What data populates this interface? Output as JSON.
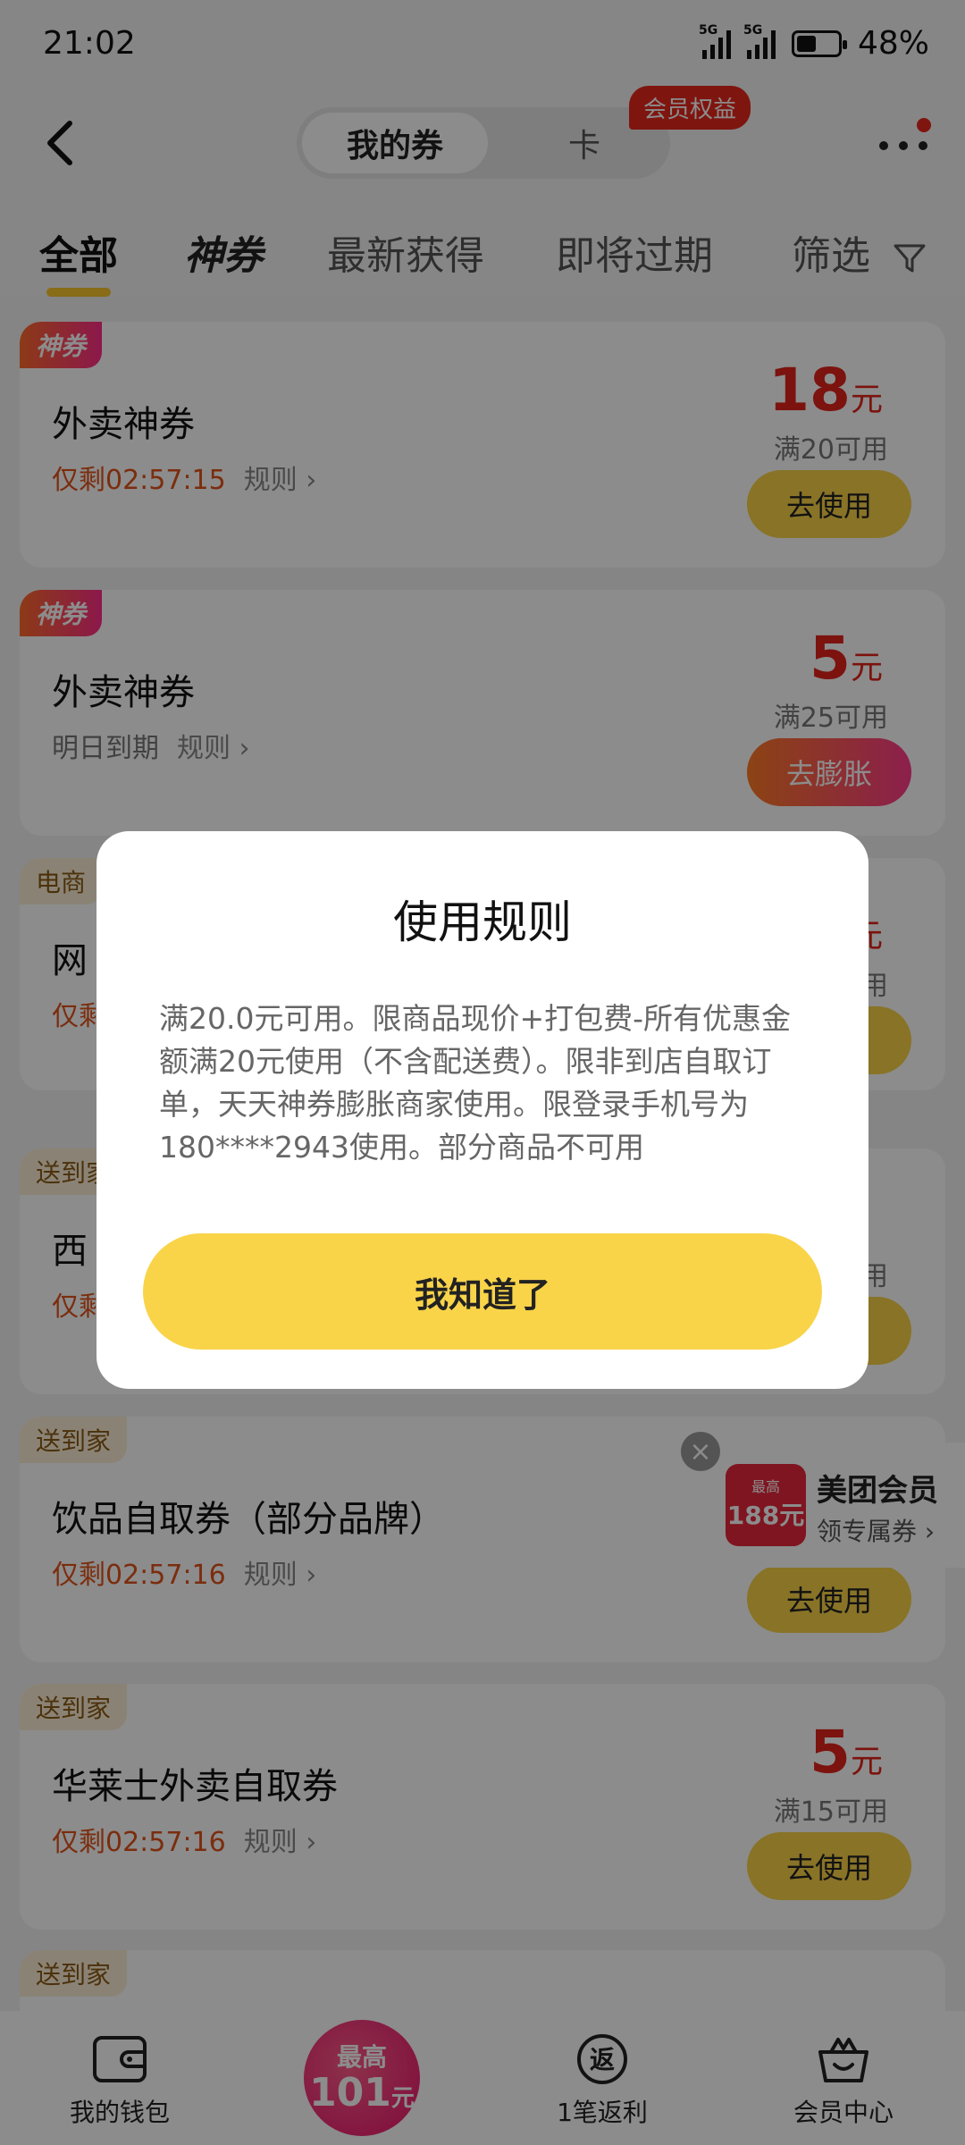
{
  "status": {
    "time": "21:02",
    "battery": "48%",
    "battery_level": 0.48,
    "net1": "5G",
    "net2": "5G"
  },
  "header": {
    "seg_active": "我的券",
    "seg_inactive": "卡",
    "vip_badge": "会员权益"
  },
  "tabs": [
    "全部",
    "神券",
    "最新获得",
    "即将过期",
    "筛选"
  ],
  "cards": [
    {
      "badge": "神券",
      "title": "外卖神券",
      "sub": "仅剩02:57:15",
      "rule": "规则 ›",
      "amount": "18",
      "unit": "元",
      "cond": "满20可用",
      "btn": "去使用"
    },
    {
      "badge": "神券",
      "title": "外卖神券",
      "sub": "明日到期",
      "rule": "规则 ›",
      "amount": "5",
      "unit": "元",
      "cond": "满25可用",
      "btn": "去膨胀"
    },
    {
      "badge": "电商",
      "title": "网",
      "sub": "仅剩",
      "unit": "元",
      "cond": "用",
      "btn": "用"
    },
    {
      "badge": "送到家",
      "title": "西",
      "sub": "仅剩",
      "cond": "用",
      "btn": "用"
    },
    {
      "badge": "送到家",
      "title": "饮品自取券（部分品牌）",
      "sub": "仅剩02:57:16",
      "rule": "规则 ›",
      "btn": "去使用"
    },
    {
      "badge": "送到家",
      "title": "华莱士外卖自取券",
      "sub": "仅剩02:57:16",
      "rule": "规则 ›",
      "amount": "5",
      "unit": "元",
      "cond": "满15可用",
      "btn": "去使用"
    },
    {
      "badge": "送到家"
    }
  ],
  "float_vip": {
    "coupon_top": "最高",
    "coupon_amount": "188元",
    "title": "美团会员",
    "sub": "领专属券 ›",
    "close": "×"
  },
  "bottom_nav": {
    "wallet": "我的钱包",
    "center_top": "最高",
    "center_amount": "101",
    "center_unit": "元",
    "rebate": "1笔返利",
    "rebate_icon": "返",
    "vip_center": "会员中心"
  },
  "modal": {
    "title": "使用规则",
    "body": "满20.0元可用。限商品现价+打包费-所有优惠金额满20元使用（不含配送费）。限非到店自取订单，天天神券膨胀商家使用。限登录手机号为180****2943使用。部分商品不可用",
    "button": "我知道了"
  }
}
